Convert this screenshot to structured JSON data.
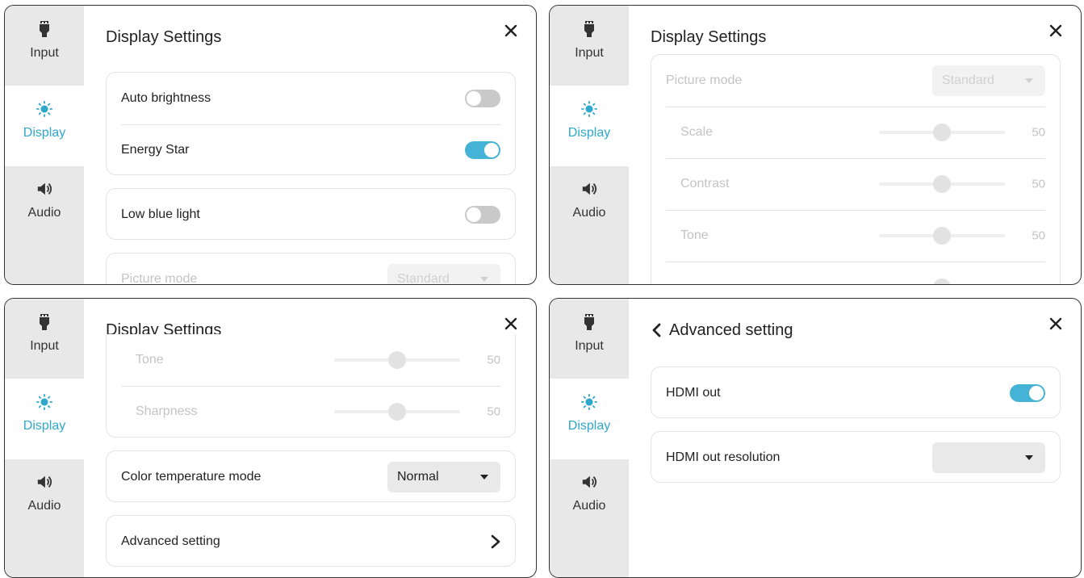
{
  "sidebar": {
    "input_label": "Input",
    "display_label": "Display",
    "audio_label": "Audio"
  },
  "panel1": {
    "title": "Display Settings",
    "auto_brightness": {
      "label": "Auto brightness",
      "on": false
    },
    "energy_star": {
      "label": "Energy Star",
      "on": true
    },
    "low_blue_light": {
      "label": "Low blue light",
      "on": false
    },
    "picture_mode": {
      "label": "Picture mode",
      "value": "Standard"
    }
  },
  "panel2": {
    "title": "Display Settings",
    "picture_mode": {
      "label": "Picture mode",
      "value": "Standard"
    },
    "sliders": [
      {
        "label": "Scale",
        "value": "50"
      },
      {
        "label": "Contrast",
        "value": "50"
      },
      {
        "label": "Tone",
        "value": "50"
      }
    ]
  },
  "panel3": {
    "title": "Display Settings",
    "sliders": [
      {
        "label": "Tone",
        "value": "50"
      },
      {
        "label": "Sharpness",
        "value": "50"
      }
    ],
    "color_temp": {
      "label": "Color temperature mode",
      "value": "Normal"
    },
    "advanced": {
      "label": "Advanced setting"
    }
  },
  "panel4": {
    "title": "Advanced setting",
    "hdmi_out": {
      "label": "HDMI out",
      "on": true
    },
    "hdmi_resolution": {
      "label": "HDMI out resolution",
      "value": ""
    }
  },
  "colors": {
    "accent": "#45b3d6",
    "sidebar": "#e8e8e8",
    "active_text": "#2fa8cc"
  },
  "icons": [
    "input-plug-icon",
    "brightness-sun-icon",
    "speaker-icon",
    "close-icon",
    "chevron-right-icon",
    "back-chevron-icon",
    "dropdown-arrow-icon"
  ]
}
